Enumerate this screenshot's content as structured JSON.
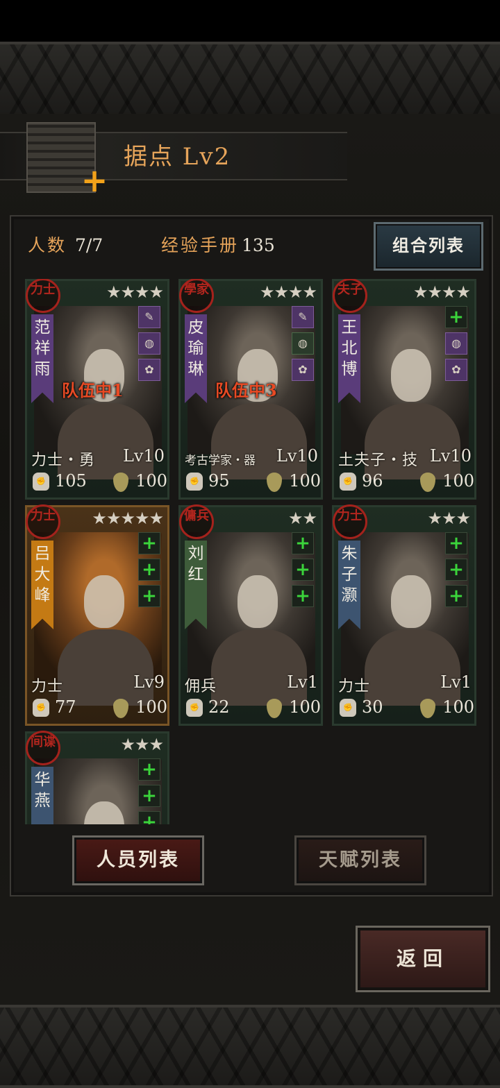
{
  "header": {
    "title": "据点  Lv2"
  },
  "stats": {
    "people_label": "人数",
    "people_value": "7/7",
    "exp_label": "经验手册",
    "exp_value": "135"
  },
  "combo_button": "组合列表",
  "cards": [
    {
      "seal": "力士",
      "stars": "★★★★",
      "name": "范祥雨",
      "team": "队伍中1",
      "role": "力士・勇",
      "lv": "Lv10",
      "power": "105",
      "stamina": "100",
      "slots": [
        "✎",
        "◍",
        "✿"
      ]
    },
    {
      "seal": "學家",
      "stars": "★★★★",
      "name": "皮瑜琳",
      "team": "队伍中3",
      "role": "考古学家・器",
      "lv": "Lv10",
      "power": "95",
      "stamina": "100",
      "slots": [
        "✎",
        "◍",
        "✿"
      ]
    },
    {
      "seal": "夫子",
      "stars": "★★★★",
      "name": "王北博",
      "team": "",
      "role": "土夫子・技",
      "lv": "Lv10",
      "power": "96",
      "stamina": "100",
      "slots": [
        "+",
        "◍",
        "✿"
      ]
    },
    {
      "seal": "力士",
      "stars": "★★★★★",
      "name": "吕大峰",
      "team": "",
      "role": "力士",
      "lv": "Lv9",
      "power": "77",
      "stamina": "100",
      "slots": [
        "+",
        "+",
        "+"
      ]
    },
    {
      "seal": "傭兵",
      "stars": "★★",
      "name": "刘红",
      "team": "",
      "role": "佣兵",
      "lv": "Lv1",
      "power": "22",
      "stamina": "100",
      "slots": [
        "+",
        "+",
        "+"
      ]
    },
    {
      "seal": "力士",
      "stars": "★★★",
      "name": "朱子灏",
      "team": "",
      "role": "力士",
      "lv": "Lv1",
      "power": "30",
      "stamina": "100",
      "slots": [
        "+",
        "+",
        "+"
      ]
    },
    {
      "seal": "间谍",
      "stars": "★★★",
      "name": "华燕",
      "team": "",
      "role": "",
      "lv": "",
      "power": "",
      "stamina": "",
      "slots": [
        "+",
        "+",
        "+"
      ]
    }
  ],
  "tabs": {
    "members": "人员列表",
    "talents": "天赋列表"
  },
  "back_button": "返回",
  "colors": {
    "accent": "#e6a45a",
    "team_tag": "#e84a24",
    "plus": "#3bd43b"
  }
}
